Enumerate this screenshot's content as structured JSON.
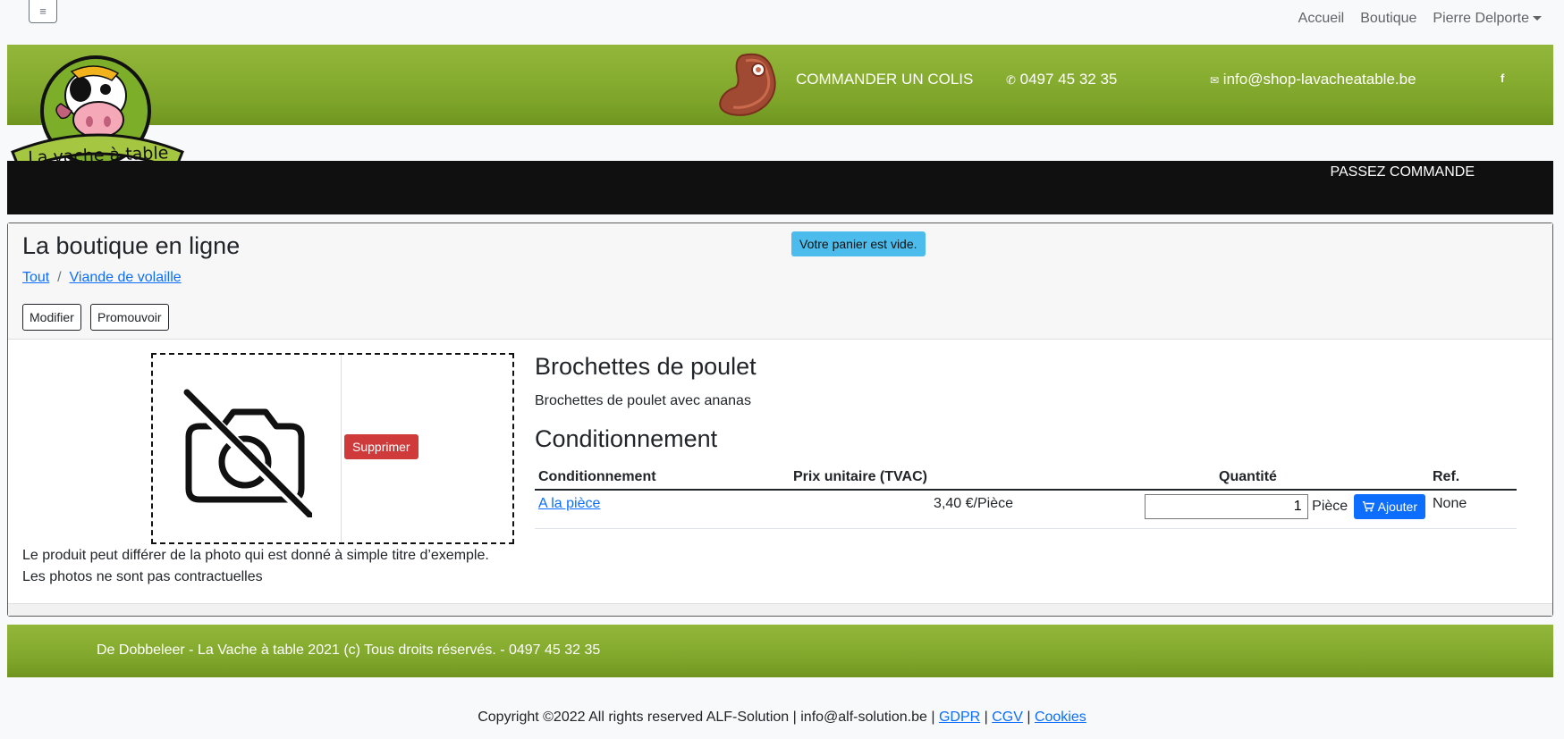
{
  "nav": {
    "menu_icon": "hamburger-icon",
    "items": [
      "Accueil",
      "Boutique",
      "Pierre Delporte"
    ]
  },
  "header": {
    "logo_text": "La vache à table",
    "order_label": "COMMANDER UN COLIS",
    "phone": "0497 45 32 35",
    "email": "info@shop-lavacheatable.be",
    "facebook": "f",
    "passez": "PASSEZ COMMANDE",
    "brand_green": "#7ea52a"
  },
  "shop": {
    "title": "La boutique en ligne",
    "breadcrumb": [
      "Tout",
      "Viande de volaille"
    ],
    "breadcrumb_sep": "/",
    "modify": "Modifier",
    "promote": "Promouvoir",
    "cart_alert": "Votre panier est vide."
  },
  "product": {
    "delete_label": "Supprimer",
    "disclaimer_1": "Le produit peut différer de la photo qui est donné à simple titre d’exemple.",
    "disclaimer_2": "Les photos ne sont pas contractuelles",
    "name": "Brochettes de poulet",
    "description": "Brochettes de poulet avec ananas",
    "cond_title": "Conditionnement",
    "table": {
      "headers": [
        "Conditionnement",
        "Prix unitaire (TVAC)",
        "Quantité",
        "Ref."
      ],
      "row": {
        "cond": "A la pièce",
        "price": "3,40 €/Pièce",
        "qty": "1",
        "unit": "Pièce",
        "add": "Ajouter",
        "ref": "None"
      }
    }
  },
  "footer": {
    "text": "De Dobbeleer - La Vache à table 2021 (c) Tous droits réservés. - 0497 45 32 35",
    "copyright": "Copyright ©2022 All rights reserved ALF-Solution | info@alf-solution.be |",
    "gdpr": "GDPR",
    "cgv": "CGV",
    "cookies": "Cookies"
  }
}
